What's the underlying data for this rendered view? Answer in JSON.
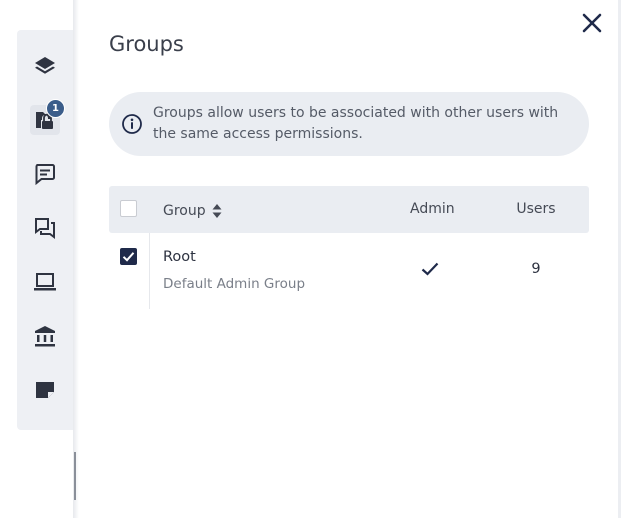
{
  "sidebar": {
    "items": [
      {
        "icon": "layers-icon"
      },
      {
        "icon": "folder-lock-icon",
        "badge": "1",
        "active": true
      },
      {
        "icon": "comment-icon"
      },
      {
        "icon": "forum-icon"
      },
      {
        "icon": "laptop-icon"
      },
      {
        "icon": "bank-icon"
      },
      {
        "icon": "note-icon"
      }
    ]
  },
  "panel": {
    "title": "Groups",
    "close_icon": "close-icon",
    "info": {
      "icon": "info-icon",
      "text": "Groups allow users to be associated with other users with the same access permissions."
    }
  },
  "table": {
    "columns": {
      "group": "Group",
      "admin": "Admin",
      "users": "Users"
    },
    "rows": [
      {
        "name": "Root",
        "description": "Default Admin Group",
        "admin": true,
        "users": "9",
        "selected": true
      }
    ]
  },
  "colors": {
    "accent": "#1f2a4a",
    "badge": "#3b5d8a",
    "panel_bg": "#eaedf2"
  }
}
